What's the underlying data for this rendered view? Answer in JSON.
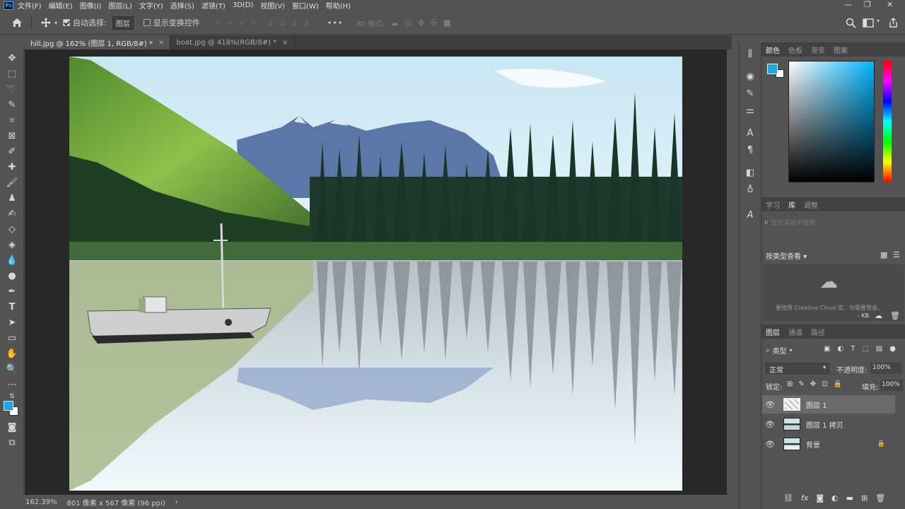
{
  "menu": {
    "app_icon": "Ps",
    "items": [
      "文件(F)",
      "编辑(E)",
      "图像(I)",
      "图层(L)",
      "文字(Y)",
      "选择(S)",
      "滤镜(T)",
      "3D(D)",
      "视图(V)",
      "窗口(W)",
      "帮助(H)"
    ],
    "window_controls": {
      "minimize": "—",
      "restore": "❐",
      "close": "✕"
    }
  },
  "options": {
    "home_icon": "home-icon",
    "auto_select_label": "自动选择:",
    "auto_select_value": "图层",
    "show_transform_label": "显示变换控件",
    "more": "•••",
    "mode_3d": "3D 模式:"
  },
  "tabs": [
    {
      "label": "hill.jpg @ 162% (图层 1, RGB/8#) *",
      "close": "×"
    },
    {
      "label": "boat.jpg @ 418%(RGB/8#) *",
      "close": "×"
    }
  ],
  "status": {
    "zoom": "162.39%",
    "info": "801 像素 x 567 像素 (96 ppi)",
    "arrow": "›"
  },
  "color_panel": {
    "tabs": [
      "颜色",
      "色板",
      "渐变",
      "图案"
    ],
    "fg": "#1aa8e8",
    "bg": "#ffffff"
  },
  "library_panel": {
    "tabs": [
      "学习",
      "库",
      "调整"
    ],
    "search_placeholder": "在所有库中搜索",
    "view_label": "按类型查看",
    "message": "要使用 Creative Cloud 库，你需要登录。",
    "kb": "- KB"
  },
  "layers_panel": {
    "tabs": [
      "图层",
      "通道",
      "路径"
    ],
    "filter": "类型",
    "blend_mode": "正常",
    "opacity_label": "不透明度:",
    "opacity": "100%",
    "lock_label": "锁定:",
    "fill_label": "填充:",
    "fill": "100%",
    "layers": [
      {
        "name": "图层 1",
        "selected": true
      },
      {
        "name": "图层 1 拷贝",
        "selected": false
      },
      {
        "name": "背景",
        "selected": false,
        "locked": true
      }
    ],
    "lock_icon": "🔒"
  },
  "colors": {
    "accent": "#31a8ff",
    "panel": "#535353",
    "dark": "#282828"
  }
}
